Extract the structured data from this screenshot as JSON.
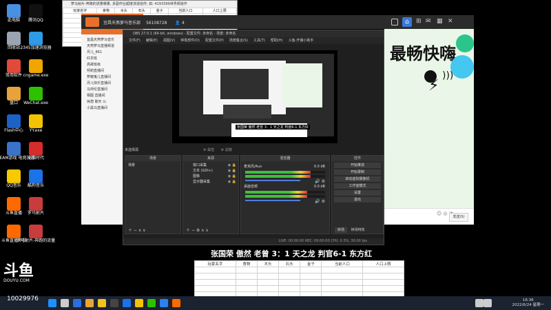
{
  "desktop_icons": [
    {
      "label": "此电脑",
      "icon": "computer-icon",
      "color": "#4a90e2"
    },
    {
      "label": "回收站",
      "icon": "recycle-bin-icon",
      "color": "#9aa5b1"
    },
    {
      "label": "常用软件",
      "icon": "folder-icon",
      "color": "#e04a3a"
    },
    {
      "label": "盘口",
      "icon": "folder-icon",
      "color": "#e9a23b"
    },
    {
      "label": "Flash中心",
      "icon": "flash-icon",
      "color": "#1b62c7"
    },
    {
      "label": "STEAM游戏 电竞加速",
      "icon": "steam-icon",
      "color": "#3a73c9"
    },
    {
      "label": "QQ音乐",
      "icon": "qqmusic-icon",
      "color": "#f6c900"
    },
    {
      "label": "斗鱼直播",
      "icon": "douyu-icon",
      "color": "#ff6a00"
    },
    {
      "label": "斗鱼直播伴侣",
      "icon": "douyu-companion-icon",
      "color": "#ff6a00"
    }
  ],
  "desktop_icons_col2": [
    {
      "label": "腾讯QQ",
      "icon": "qq-icon",
      "color": "#111111"
    },
    {
      "label": "2345加速浏览器",
      "icon": "browser-icon",
      "color": "#2f9be6"
    },
    {
      "label": "cngame.exe",
      "icon": "game-icon",
      "color": "#f0a500"
    },
    {
      "label": "WeChat.exe",
      "icon": "wechat-icon",
      "color": "#2dc100"
    },
    {
      "label": "YY.exe",
      "icon": "yy-icon",
      "color": "#f3c300"
    },
    {
      "label": "电脑时代",
      "icon": "app-icon",
      "color": "#d62c2c"
    },
    {
      "label": "酷狗音乐",
      "icon": "kugou-icon",
      "color": "#1a73e8"
    },
    {
      "label": "罗马射片",
      "icon": "app-icon",
      "color": "#c93c3c"
    },
    {
      "label": "罗马射片-奔跑的流量",
      "icon": "app-icon",
      "color": "#c93c3c"
    }
  ],
  "xls_window": {
    "title": "萝马射片-奔跑的流量曝量, 多副作业超度流道拍作, 如: 4193399世界频道作",
    "headers": [
      "玩家名字",
      "食物",
      "木头",
      "石头",
      "金子",
      "当前人口",
      "人口上限"
    ]
  },
  "yy_window": {
    "title": "宜昌天燕萝马音乐部",
    "id": "56108728",
    "count": "4",
    "tree": [
      "宜昌天燕萝马音乐",
      "天燕萝马直播频道",
      "月儿_861",
      "红衣班",
      "高歌班级",
      "柯莉直播间",
      "萝嬷鬼儿直播间",
      "月儿快乐直播间",
      "马帅伦直播间",
      "相图 直播间",
      "休憩 聊天 公",
      "小黑马直播间"
    ]
  },
  "obs": {
    "title": "OBS 27.0.1 (64-bit, windows) - 配置文件: 未命名 - 场景: 未命名",
    "menu": [
      "文件(F)",
      "编辑(E)",
      "视图(V)",
      "停靠部件(D)",
      "配置文件(P)",
      "场景集合(S)",
      "工具(T)",
      "帮助(H)",
      "斗鱼-开播小助手"
    ],
    "no_source": "未选择源",
    "properties": "属性",
    "filters": "滤镜",
    "docks": {
      "scenes": {
        "title": "场景",
        "items": [
          "场景"
        ]
      },
      "sources": {
        "title": "来源",
        "items": [
          "窗口采集",
          "文本 (GDI+)",
          "图像",
          "显示器采集"
        ]
      },
      "mixer": {
        "title": "混音器",
        "items": [
          {
            "name": "麦克风/Aux",
            "db": "0.0 dB",
            "level": 0.82
          },
          {
            "name": "桌面音频",
            "db": "0.0 dB",
            "level": 0.78
          }
        ]
      },
      "controls": {
        "title": "控件",
        "buttons": [
          "开始推流",
          "开始录制",
          "启动虚拟摄像机",
          "工作室模式",
          "设置",
          "退出"
        ]
      }
    },
    "tabs": [
      "转场",
      "转场特效"
    ],
    "status": "LIVE: 00:00:00   REC: 00:00:00   CPU: 0.3%, 30.00 fps"
  },
  "green_panel": {
    "headline": "最畅快嗨",
    "button": "发送(S)",
    "icons": [
      "home-icon",
      "gamepad-icon",
      "gift-icon",
      "grid-icon"
    ]
  },
  "subtitle": "张国荣 傲然 老曾 3：1 天之龙 判官6-1 东方红",
  "sheet": {
    "headers": [
      "玩家名字",
      "食物",
      "木头",
      "石头",
      "金子",
      "当前人口",
      "人口上限"
    ]
  },
  "watermark": {
    "brand": "斗鱼",
    "site": "DOUYU.COM",
    "room": "10029976"
  },
  "clock": {
    "time": "16:36",
    "date": "2022/6/24 星期一"
  },
  "taskbar_icons": [
    "windows-icon",
    "search-icon",
    "edge-icon",
    "chrome-icon",
    "explorer-icon",
    "obs-icon",
    "kugou-icon",
    "yy-icon",
    "wechat-icon",
    "shield-icon",
    "douyu-icon",
    "network-icon",
    "volume-icon"
  ]
}
